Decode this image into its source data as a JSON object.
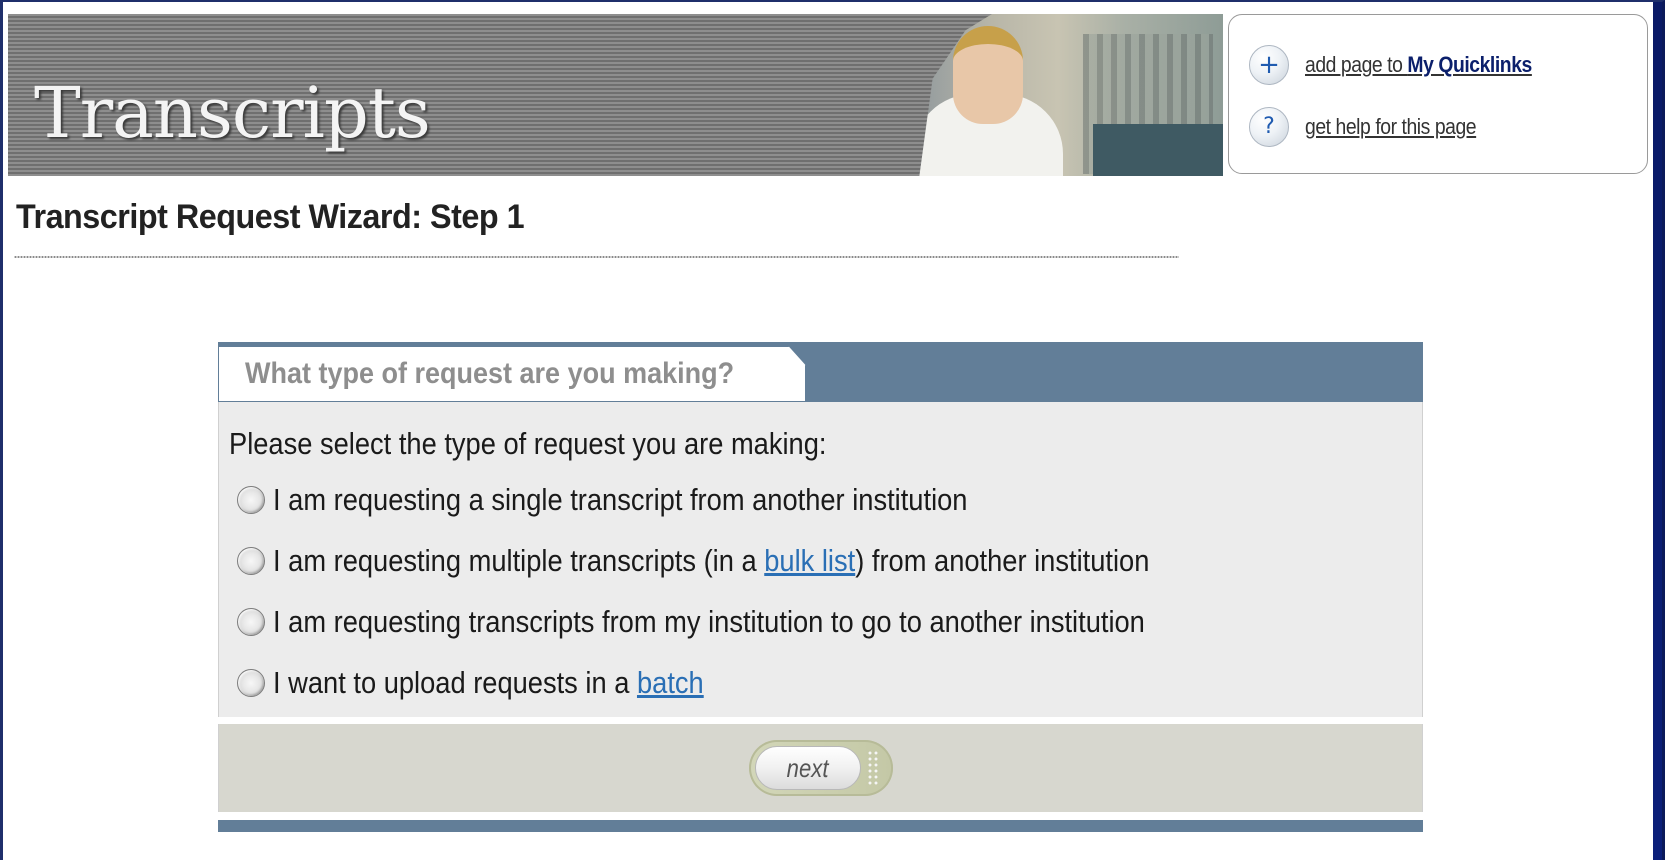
{
  "banner": {
    "title": "Transcripts"
  },
  "quicklinks": {
    "add": {
      "icon": "plus-icon",
      "prefix": "add page to ",
      "emphasis": "My Quicklinks"
    },
    "help": {
      "icon": "question-icon",
      "label": "get help for this page"
    }
  },
  "page": {
    "title": "Transcript Request Wizard: Step 1"
  },
  "panel": {
    "tab_label": "What type of request are you making?",
    "prompt": "Please select the type of request you are making:",
    "options": [
      {
        "text": "I am requesting a single transcript from another institution"
      },
      {
        "before": "I am requesting multiple transcripts (in a ",
        "link": "bulk list",
        "after": ") from another institution"
      },
      {
        "text": "I am requesting transcripts from my institution to go to another institution"
      },
      {
        "before": "I want to upload requests in a ",
        "link": "batch"
      }
    ],
    "next_label": "next"
  },
  "colors": {
    "panel_header": "#627e98",
    "panel_body": "#ececec",
    "panel_footer": "#d7d7cf",
    "link": "#2a6fb5",
    "window_border": "#0b1a5a"
  }
}
